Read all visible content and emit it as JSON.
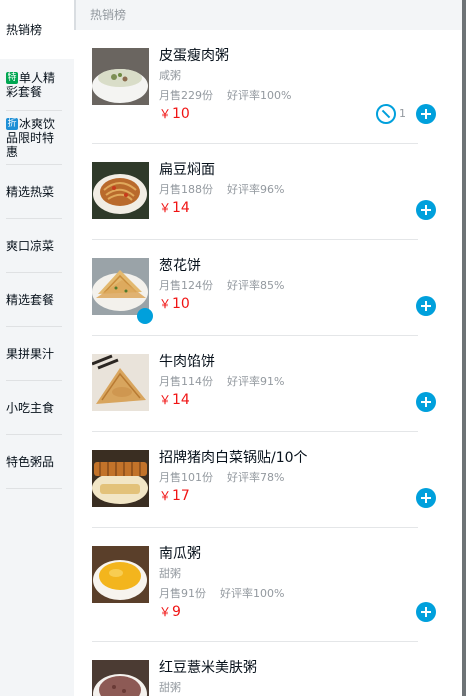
{
  "sidebar": {
    "categories": [
      {
        "label": "热销榜",
        "tag": "",
        "tag_color": ""
      },
      {
        "label": "单人精彩套餐",
        "tag": "特",
        "tag_color": "#00a651"
      },
      {
        "label": "冰爽饮品限时特惠",
        "tag": "折",
        "tag_color": "#1e8fd6"
      },
      {
        "label": "精选热菜",
        "tag": "",
        "tag_color": ""
      },
      {
        "label": "爽口凉菜",
        "tag": "",
        "tag_color": ""
      },
      {
        "label": "精选套餐",
        "tag": "",
        "tag_color": ""
      },
      {
        "label": "果拼果汁",
        "tag": "",
        "tag_color": ""
      },
      {
        "label": "小吃主食",
        "tag": "",
        "tag_color": ""
      },
      {
        "label": "特色粥品",
        "tag": "",
        "tag_color": ""
      }
    ]
  },
  "main": {
    "section_title": "热销榜",
    "currency": "￥",
    "foods": [
      {
        "name": "皮蛋瘦肉粥",
        "desc": "咸粥",
        "sales": "月售229份",
        "rating": "好评率100%",
        "price": "10",
        "count": "1",
        "icon": "porridge-image"
      },
      {
        "name": "扁豆焖面",
        "desc": "",
        "sales": "月售188份",
        "rating": "好评率96%",
        "price": "14",
        "count": "",
        "icon": "noodles-image"
      },
      {
        "name": "葱花饼",
        "desc": "",
        "sales": "月售124份",
        "rating": "好评率85%",
        "price": "10",
        "count": "",
        "icon": "pancake-image"
      },
      {
        "name": "牛肉馅饼",
        "desc": "",
        "sales": "月售114份",
        "rating": "好评率91%",
        "price": "14",
        "count": "",
        "icon": "meat-pie-image"
      },
      {
        "name": "招牌猪肉白菜锅贴/10个",
        "desc": "",
        "sales": "月售101份",
        "rating": "好评率78%",
        "price": "17",
        "count": "",
        "icon": "potsticker-image"
      },
      {
        "name": "南瓜粥",
        "desc": "甜粥",
        "sales": "月售91份",
        "rating": "好评率100%",
        "price": "9",
        "count": "",
        "icon": "pumpkin-porridge-image"
      },
      {
        "name": "红豆薏米美肤粥",
        "desc": "甜粥",
        "sales": "",
        "rating": "",
        "price": "",
        "count": "",
        "icon": "red-bean-porridge-image"
      }
    ]
  },
  "colors": {
    "accent": "#00a0dc",
    "price": "#f01414",
    "muted": "#93999f",
    "sidebar_bg": "#f3f5f7"
  }
}
